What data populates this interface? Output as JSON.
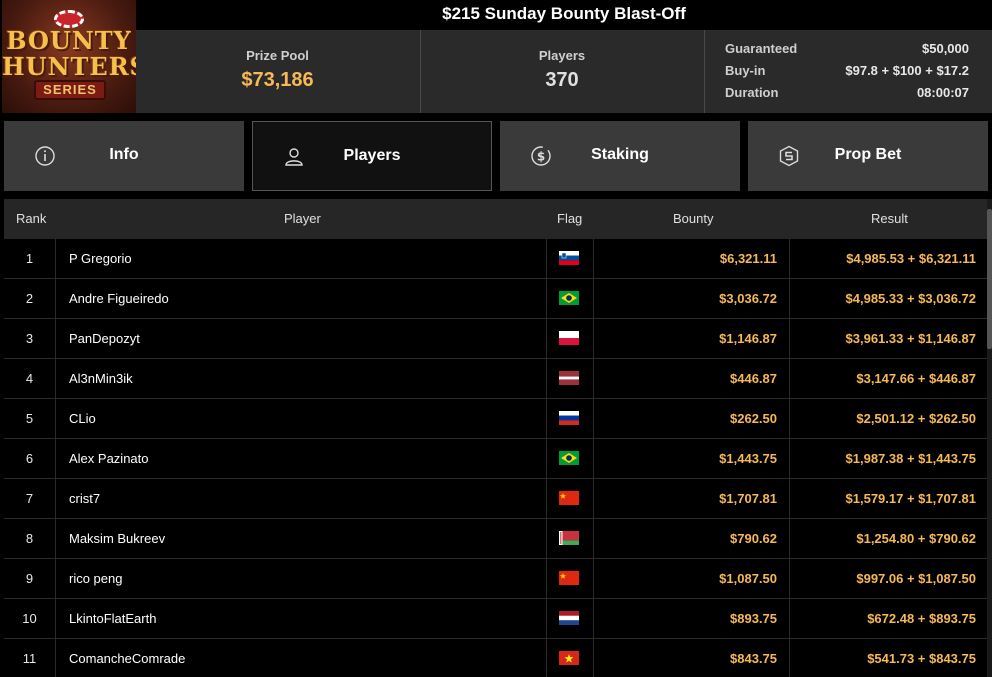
{
  "header": {
    "title": "$215 Sunday Bounty Blast-Off",
    "logo": {
      "line1": "BOUNTY",
      "line2": "HUNTERS",
      "line3": "SERIES"
    }
  },
  "stats": {
    "prize_pool_label": "Prize Pool",
    "prize_pool_value": "$73,186",
    "players_label": "Players",
    "players_value": "370",
    "details": [
      {
        "label": "Guaranteed",
        "value": "$50,000"
      },
      {
        "label": "Buy-in",
        "value": "$97.8 + $100 + $17.2"
      },
      {
        "label": "Duration",
        "value": "08:00:07"
      }
    ]
  },
  "tabs": [
    {
      "label": "Info",
      "icon": "info-icon",
      "active": false
    },
    {
      "label": "Players",
      "icon": "user-icon",
      "active": true
    },
    {
      "label": "Staking",
      "icon": "dollar-coin-icon",
      "active": false
    },
    {
      "label": "Prop Bet",
      "icon": "prop-bet-icon",
      "active": false
    }
  ],
  "table": {
    "columns": {
      "rank": "Rank",
      "player": "Player",
      "flag": "Flag",
      "bounty": "Bounty",
      "result": "Result"
    },
    "rows": [
      {
        "rank": "1",
        "player": "P Gregorio",
        "flag": "slovenia",
        "bounty": "$6,321.11",
        "result": "$4,985.53 + $6,321.11"
      },
      {
        "rank": "2",
        "player": "Andre Figueiredo",
        "flag": "brazil",
        "bounty": "$3,036.72",
        "result": "$4,985.33 + $3,036.72"
      },
      {
        "rank": "3",
        "player": "PanDepozyt",
        "flag": "poland",
        "bounty": "$1,146.87",
        "result": "$3,961.33 + $1,146.87"
      },
      {
        "rank": "4",
        "player": "Al3nMin3ik",
        "flag": "latvia",
        "bounty": "$446.87",
        "result": "$3,147.66 + $446.87"
      },
      {
        "rank": "5",
        "player": "CLio",
        "flag": "russia",
        "bounty": "$262.50",
        "result": "$2,501.12 + $262.50"
      },
      {
        "rank": "6",
        "player": "Alex Pazinato",
        "flag": "brazil",
        "bounty": "$1,443.75",
        "result": "$1,987.38 + $1,443.75"
      },
      {
        "rank": "7",
        "player": "crist7",
        "flag": "china",
        "bounty": "$1,707.81",
        "result": "$1,579.17 + $1,707.81"
      },
      {
        "rank": "8",
        "player": "Maksim Bukreev",
        "flag": "belarus",
        "bounty": "$790.62",
        "result": "$1,254.80 + $790.62"
      },
      {
        "rank": "9",
        "player": "rico peng",
        "flag": "china",
        "bounty": "$1,087.50",
        "result": "$997.06 + $1,087.50"
      },
      {
        "rank": "10",
        "player": "LkintoFlatEarth",
        "flag": "netherlands",
        "bounty": "$893.75",
        "result": "$672.48 + $893.75"
      },
      {
        "rank": "11",
        "player": "ComancheComrade",
        "flag": "vietnam",
        "bounty": "$843.75",
        "result": "$541.73 + $843.75"
      }
    ]
  },
  "colors": {
    "accent_gold": "#f7b955",
    "tab_bg": "#3a3a3a",
    "header_bg": "#2a2a2a"
  }
}
